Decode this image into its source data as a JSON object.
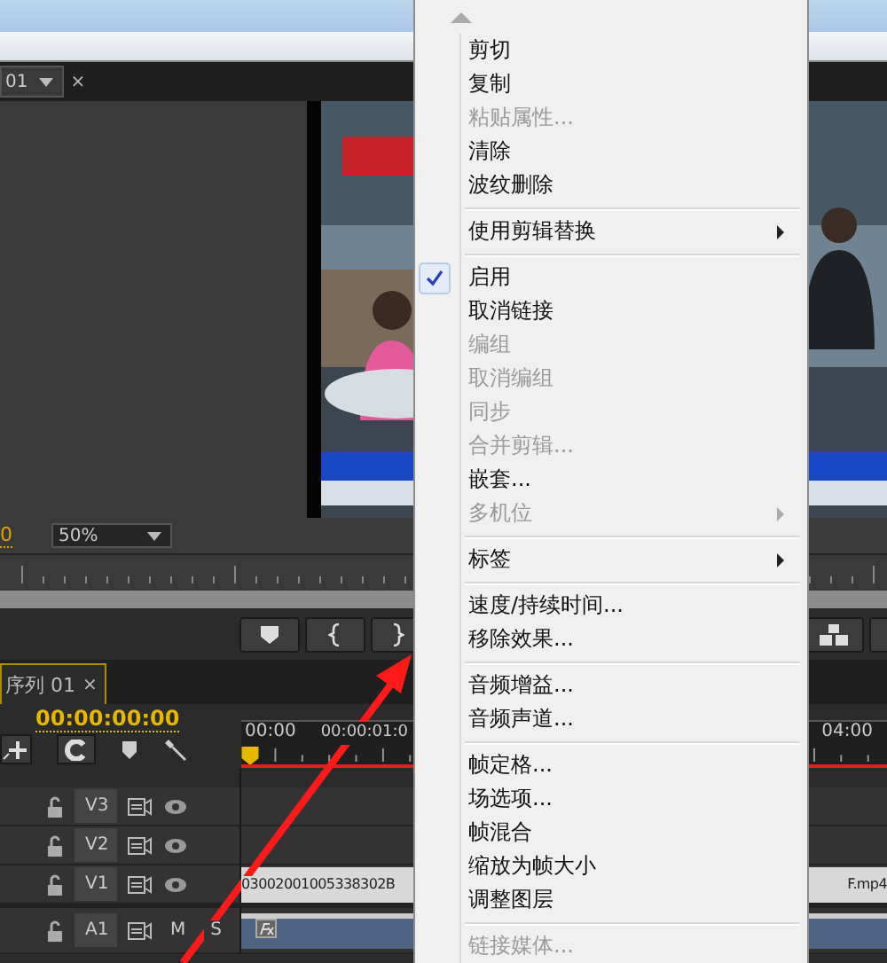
{
  "source_monitor": {
    "tab": "01",
    "tab_close": "×",
    "timecode": "0",
    "zoom": "50%"
  },
  "timeline": {
    "tab": "序列 01",
    "tab_close": "×",
    "timecode": "00:00:00:00",
    "ruler_labels": [
      "00:00",
      "00:00:01:0",
      "04:00"
    ],
    "tracks": [
      {
        "name": "V3",
        "kind": "video"
      },
      {
        "name": "V2",
        "kind": "video"
      },
      {
        "name": "V1",
        "kind": "video",
        "clip": "03002001005338302B",
        "clip_end": "F.mp4"
      },
      {
        "name": "A1",
        "kind": "audio",
        "buttons": [
          "M",
          "S"
        ]
      }
    ]
  },
  "context_menu": [
    {
      "kind": "item",
      "label": "剪切",
      "disabled": false,
      "checked": false,
      "submenu": false
    },
    {
      "kind": "item",
      "label": "复制",
      "disabled": false,
      "checked": false,
      "submenu": false
    },
    {
      "kind": "item",
      "label": "粘贴属性...",
      "disabled": true,
      "checked": false,
      "submenu": false
    },
    {
      "kind": "item",
      "label": "清除",
      "disabled": false,
      "checked": false,
      "submenu": false
    },
    {
      "kind": "item",
      "label": "波纹删除",
      "disabled": false,
      "checked": false,
      "submenu": false
    },
    {
      "kind": "separator"
    },
    {
      "kind": "item",
      "label": "使用剪辑替换",
      "disabled": false,
      "checked": false,
      "submenu": true
    },
    {
      "kind": "separator"
    },
    {
      "kind": "item",
      "label": "启用",
      "disabled": false,
      "checked": true,
      "submenu": false
    },
    {
      "kind": "item",
      "label": "取消链接",
      "disabled": false,
      "checked": false,
      "submenu": false
    },
    {
      "kind": "item",
      "label": "编组",
      "disabled": true,
      "checked": false,
      "submenu": false
    },
    {
      "kind": "item",
      "label": "取消编组",
      "disabled": true,
      "checked": false,
      "submenu": false
    },
    {
      "kind": "item",
      "label": "同步",
      "disabled": true,
      "checked": false,
      "submenu": false
    },
    {
      "kind": "item",
      "label": "合并剪辑...",
      "disabled": true,
      "checked": false,
      "submenu": false
    },
    {
      "kind": "item",
      "label": "嵌套...",
      "disabled": false,
      "checked": false,
      "submenu": false
    },
    {
      "kind": "item",
      "label": "多机位",
      "disabled": true,
      "checked": false,
      "submenu": true
    },
    {
      "kind": "separator"
    },
    {
      "kind": "item",
      "label": "标签",
      "disabled": false,
      "checked": false,
      "submenu": true
    },
    {
      "kind": "separator"
    },
    {
      "kind": "item",
      "label": "速度/持续时间...",
      "disabled": false,
      "checked": false,
      "submenu": false
    },
    {
      "kind": "item",
      "label": "移除效果...",
      "disabled": false,
      "checked": false,
      "submenu": false
    },
    {
      "kind": "separator"
    },
    {
      "kind": "item",
      "label": "音频增益...",
      "disabled": false,
      "checked": false,
      "submenu": false
    },
    {
      "kind": "item",
      "label": "音频声道...",
      "disabled": false,
      "checked": false,
      "submenu": false
    },
    {
      "kind": "separator"
    },
    {
      "kind": "item",
      "label": "帧定格...",
      "disabled": false,
      "checked": false,
      "submenu": false
    },
    {
      "kind": "item",
      "label": "场选项...",
      "disabled": false,
      "checked": false,
      "submenu": false
    },
    {
      "kind": "item",
      "label": "帧混合",
      "disabled": false,
      "checked": false,
      "submenu": false
    },
    {
      "kind": "item",
      "label": "缩放为帧大小",
      "disabled": false,
      "checked": false,
      "submenu": false
    },
    {
      "kind": "item",
      "label": "调整图层",
      "disabled": false,
      "checked": false,
      "submenu": false
    },
    {
      "kind": "separator"
    },
    {
      "kind": "item",
      "label": "链接媒体...",
      "disabled": true,
      "checked": false,
      "submenu": false
    }
  ]
}
